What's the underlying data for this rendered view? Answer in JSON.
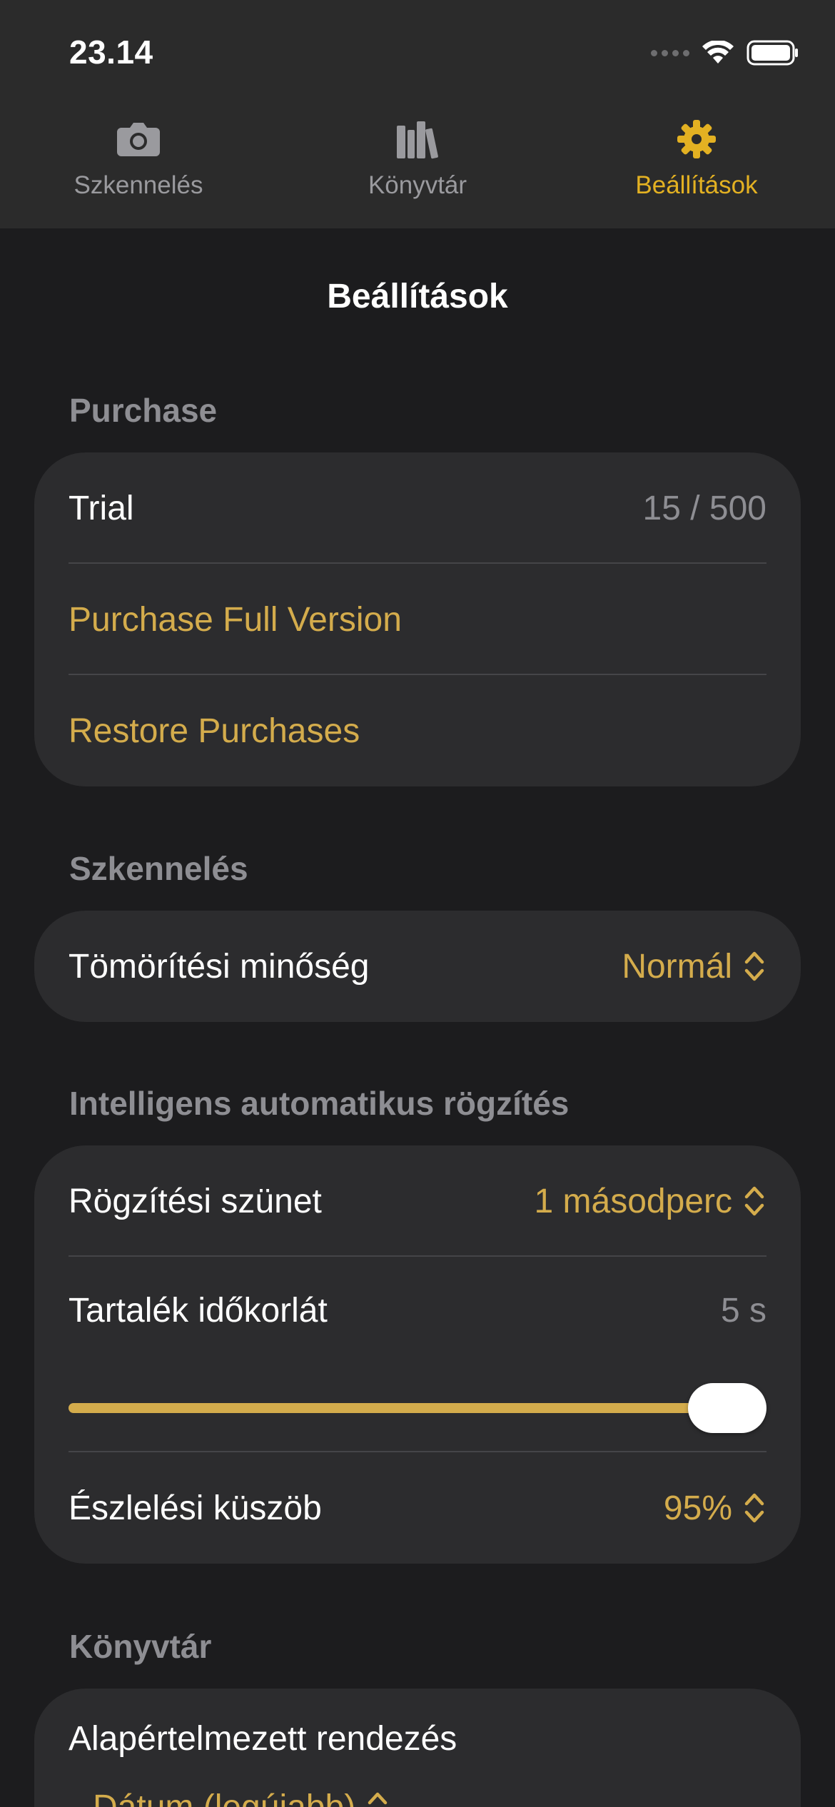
{
  "status_bar": {
    "time": "23.14"
  },
  "tabs": [
    {
      "label": "Szkennelés",
      "icon": "camera-icon",
      "active": false
    },
    {
      "label": "Könyvtár",
      "icon": "library-icon",
      "active": false
    },
    {
      "label": "Beállítások",
      "icon": "gear-icon",
      "active": true
    }
  ],
  "page": {
    "title": "Beállítások"
  },
  "purchase": {
    "header": "Purchase",
    "trial_label": "Trial",
    "trial_value": "15 / 500",
    "purchase_full": "Purchase Full Version",
    "restore": "Restore Purchases"
  },
  "scanning": {
    "header": "Szkennelés",
    "compression_label": "Tömörítési minőség",
    "compression_value": "Normál"
  },
  "smart_capture": {
    "header": "Intelligens automatikus rögzítés",
    "pause_label": "Rögzítési szünet",
    "pause_value": "1 másodperc",
    "timeout_label": "Tartalék időkorlát",
    "timeout_value": "5 s",
    "timeout_slider_fraction": 1.0,
    "threshold_label": "Észlelési küszöb",
    "threshold_value": "95%"
  },
  "library": {
    "header": "Könyvtár",
    "sort_label": "Alapértelmezett rendezés",
    "sort_value": "Dátum (legújabb)"
  },
  "colors": {
    "accent": "#d4ac4c",
    "tab_active": "#e3b122",
    "background": "#1c1c1e",
    "card": "#2c2c2e",
    "top_bar": "#2b2b2b"
  }
}
